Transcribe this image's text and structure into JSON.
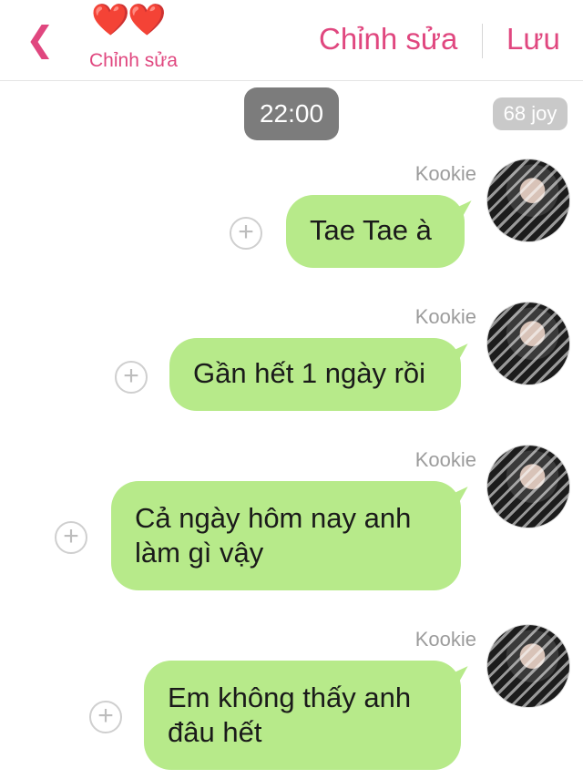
{
  "header": {
    "back_icon": "chevron-left-icon",
    "hearts": "❤️❤️",
    "subtitle": "Chỉnh sửa",
    "edit_label": "Chỉnh sửa",
    "save_label": "Lưu"
  },
  "time_divider": "22:00",
  "joy_badge": "68 joy",
  "messages": [
    {
      "sender": "Kookie",
      "line1": "Tae Tae à",
      "line2": ""
    },
    {
      "sender": "Kookie",
      "line1": "Gần hết 1 ngày rồi",
      "line2": ""
    },
    {
      "sender": "Kookie",
      "line1": "Cả ngày hôm nay anh",
      "line2": "làm gì vậy"
    },
    {
      "sender": "Kookie",
      "line1": "Em không thấy anh",
      "line2": "đâu hết"
    }
  ],
  "colors": {
    "accent": "#e0477f",
    "bubble": "#b7ea8a",
    "time_pill": "#7c7c7c"
  }
}
